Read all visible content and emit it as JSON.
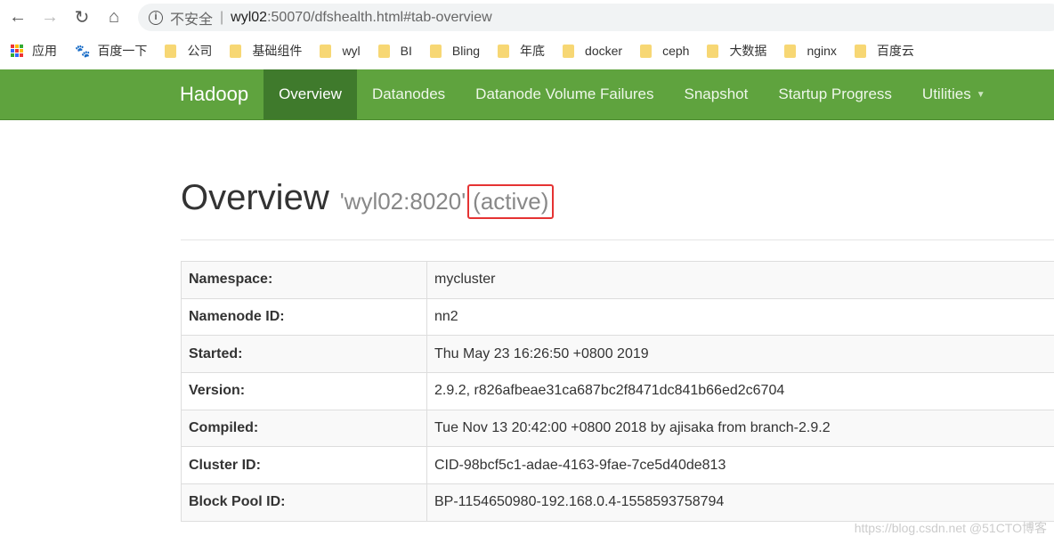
{
  "browser": {
    "security_label": "不安全",
    "url_host": "wyl02",
    "url_rest": ":50070/dfshealth.html#tab-overview"
  },
  "bookmarks": [
    "应用",
    "百度一下",
    "公司",
    "基础组件",
    "wyl",
    "BI",
    "Bling",
    "年底",
    "docker",
    "ceph",
    "大数据",
    "nginx",
    "百度云"
  ],
  "nav": {
    "brand": "Hadoop",
    "items": [
      "Overview",
      "Datanodes",
      "Datanode Volume Failures",
      "Snapshot",
      "Startup Progress",
      "Utilities"
    ]
  },
  "header": {
    "title": "Overview",
    "host": "'wyl02:8020'",
    "state": "(active)"
  },
  "table": [
    {
      "k": "Namespace:",
      "v": "mycluster"
    },
    {
      "k": "Namenode ID:",
      "v": "nn2"
    },
    {
      "k": "Started:",
      "v": "Thu May 23 16:26:50 +0800 2019"
    },
    {
      "k": "Version:",
      "v": "2.9.2, r826afbeae31ca687bc2f8471dc841b66ed2c6704"
    },
    {
      "k": "Compiled:",
      "v": "Tue Nov 13 20:42:00 +0800 2018 by ajisaka from branch-2.9.2"
    },
    {
      "k": "Cluster ID:",
      "v": "CID-98bcf5c1-adae-4163-9fae-7ce5d40de813"
    },
    {
      "k": "Block Pool ID:",
      "v": "BP-1154650980-192.168.0.4-1558593758794"
    }
  ],
  "watermark": "https://blog.csdn.net @51CTO博客",
  "colors": {
    "navbar": "#5fa33e",
    "nav_active": "#3f7a2c",
    "highlight": "#e53333"
  }
}
